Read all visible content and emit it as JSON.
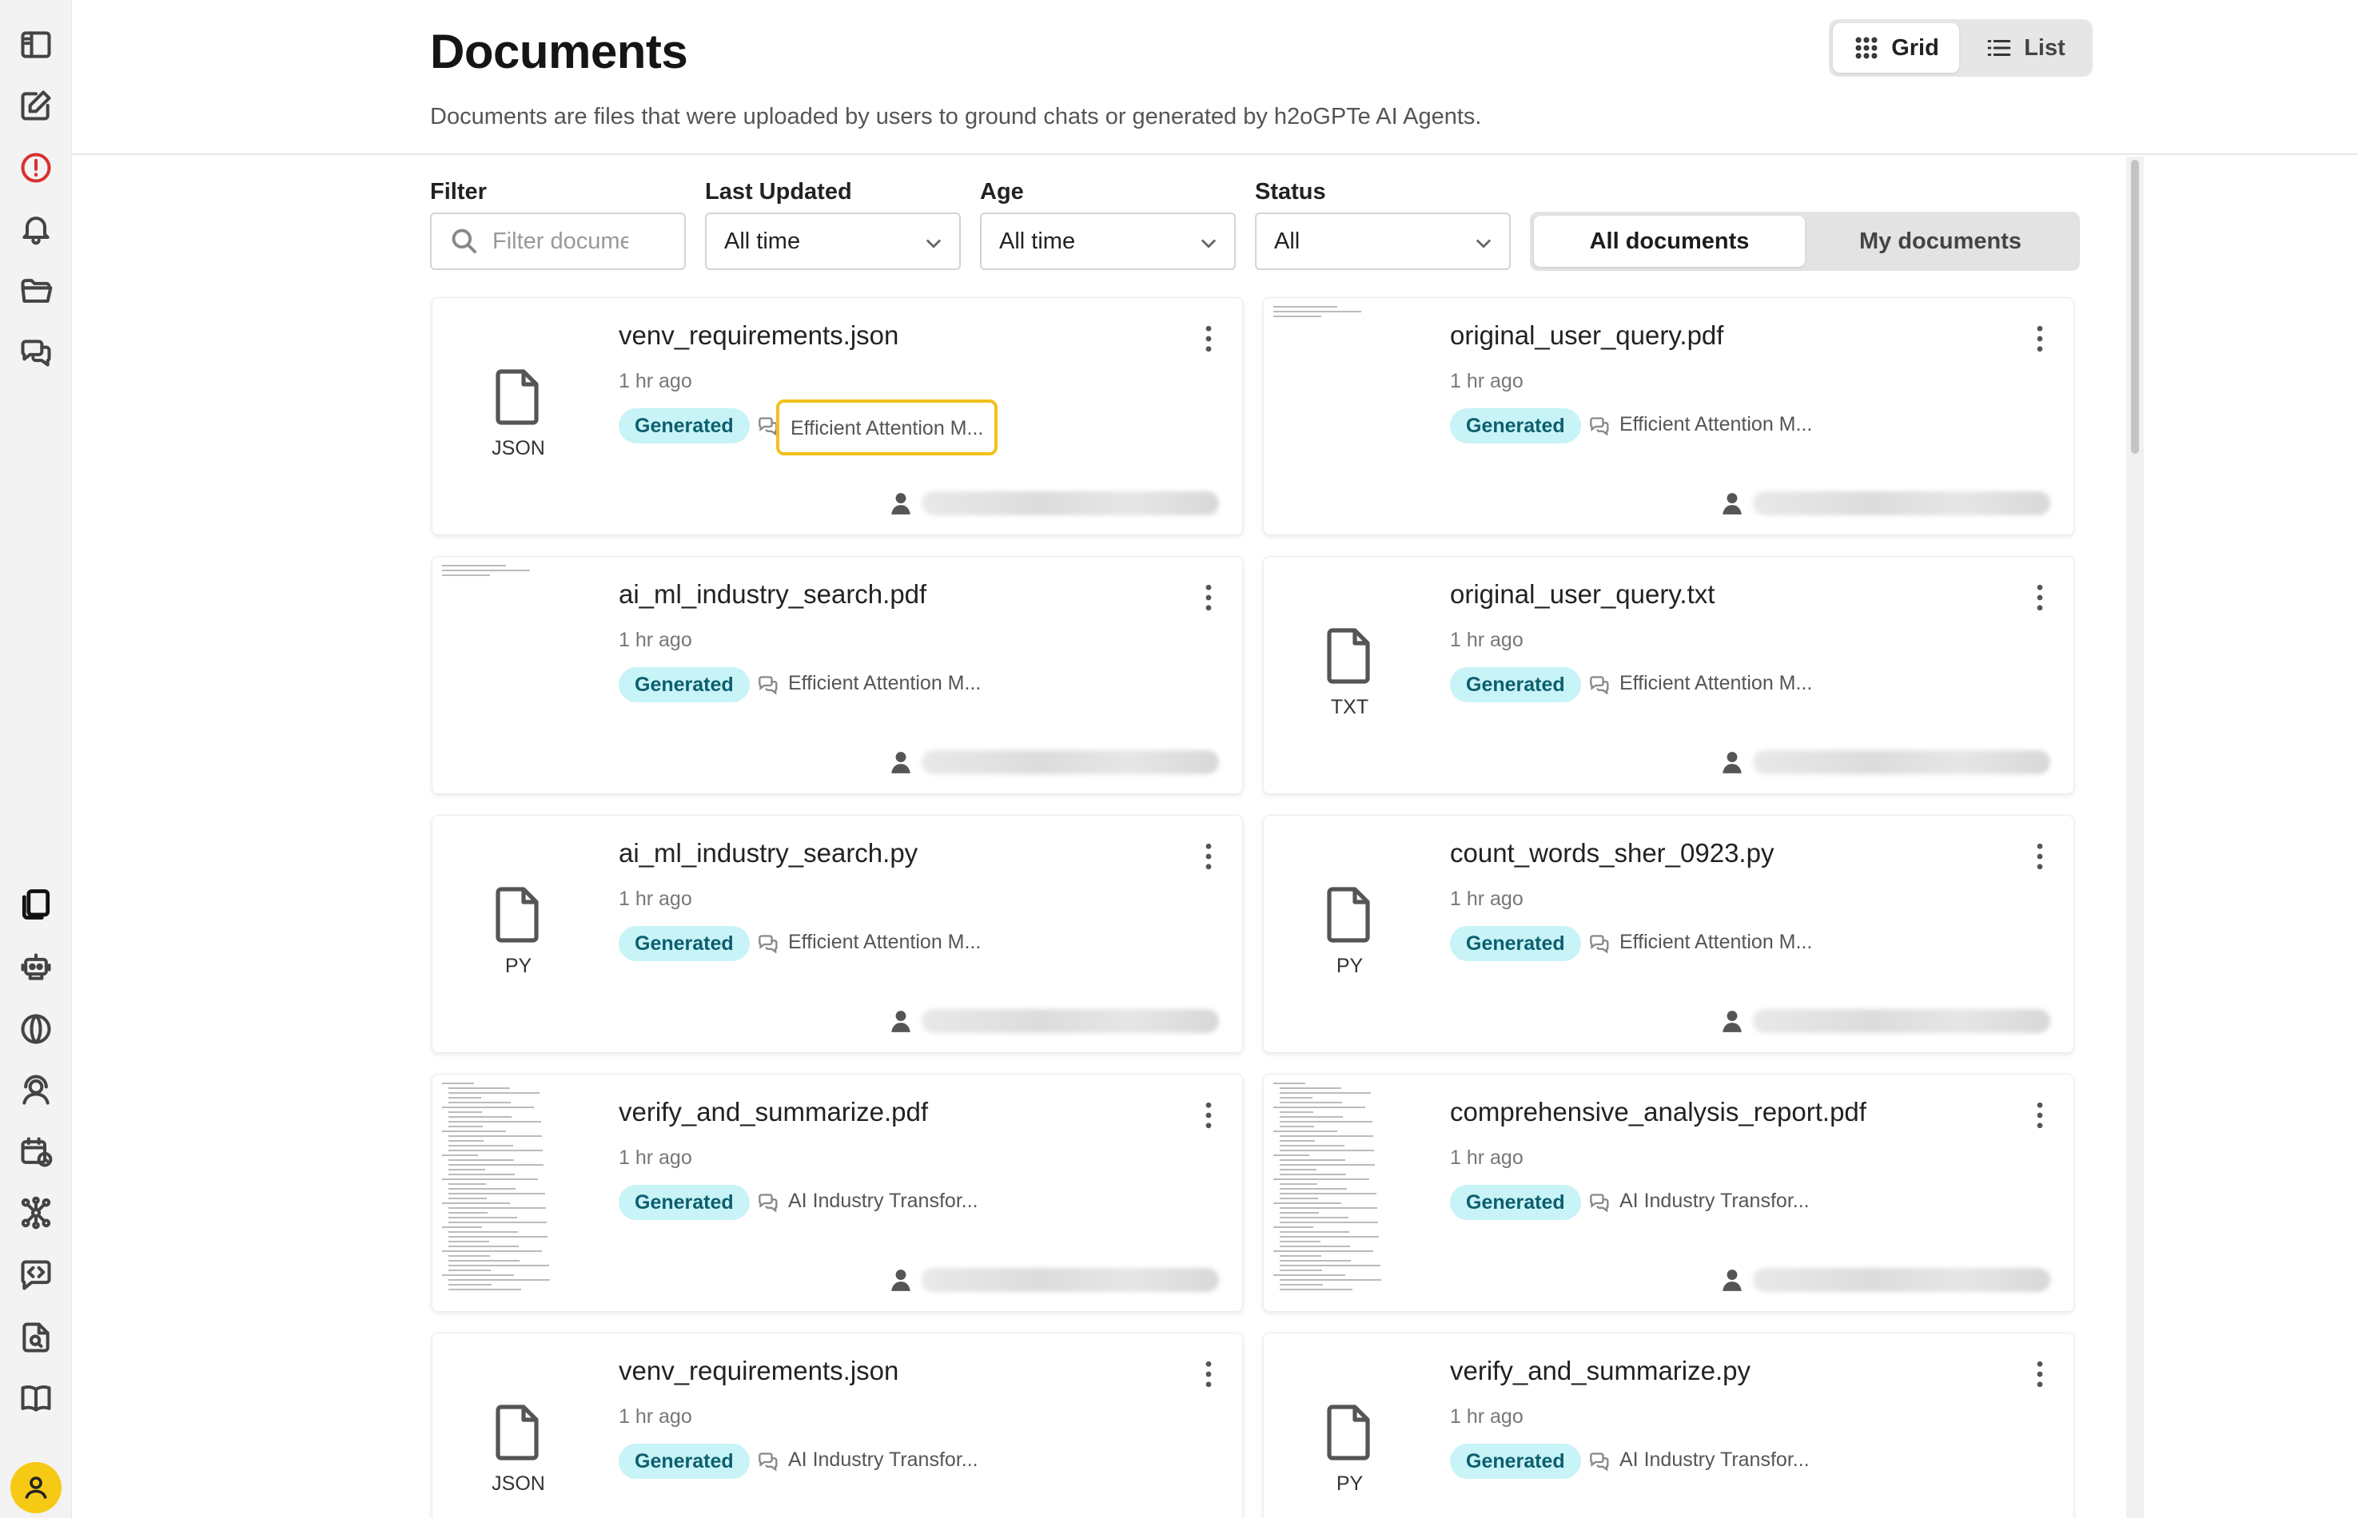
{
  "header": {
    "title": "Documents",
    "description": "Documents are files that were uploaded by users to ground chats or generated by h2oGPTe AI Agents."
  },
  "view_toggle": {
    "grid_label": "Grid",
    "list_label": "List",
    "active": "Grid"
  },
  "filters": {
    "filter_label": "Filter",
    "filter_placeholder": "Filter documents",
    "filter_value": "",
    "last_updated_label": "Last Updated",
    "last_updated_value": "All time",
    "age_label": "Age",
    "age_value": "All time",
    "status_label": "Status",
    "status_value": "All"
  },
  "scope_toggle": {
    "all_label": "All documents",
    "mine_label": "My documents",
    "active": "All documents"
  },
  "sidebar": {
    "icons": [
      "sidebar-toggle-icon",
      "new-chat-icon",
      "alert-icon",
      "bell-icon",
      "folder-icon",
      "chats-icon",
      "documents-icon",
      "agents-icon",
      "models-icon",
      "support-icon",
      "schedule-icon",
      "workflows-icon",
      "code-icon",
      "document-search-icon",
      "book-icon",
      "user-icon"
    ]
  },
  "accent_colors": {
    "badge_bg": "#c8f3f7",
    "badge_text": "#0b5f6e",
    "highlight": "#f1c21b",
    "avatar": "#f6c915"
  },
  "cards": [
    {
      "name": "venv_requirements.json",
      "time": "1 hr ago",
      "badge": "Generated",
      "chat": "Efficient Attention M...",
      "owner": "",
      "ext": "JSON",
      "preview": false
    },
    {
      "name": "original_user_query.pdf",
      "time": "1 hr ago",
      "badge": "Generated",
      "chat": "Efficient Attention M...",
      "owner": "",
      "ext": "",
      "preview": true
    },
    {
      "name": "ai_ml_industry_search.pdf",
      "time": "1 hr ago",
      "badge": "Generated",
      "chat": "Efficient Attention M...",
      "owner": "",
      "ext": "",
      "preview": true
    },
    {
      "name": "original_user_query.txt",
      "time": "1 hr ago",
      "badge": "Generated",
      "chat": "Efficient Attention M...",
      "owner": "",
      "ext": "TXT",
      "preview": false
    },
    {
      "name": "ai_ml_industry_search.py",
      "time": "1 hr ago",
      "badge": "Generated",
      "chat": "Efficient Attention M...",
      "owner": "",
      "ext": "PY",
      "preview": false
    },
    {
      "name": "count_words_sher_0923.py",
      "time": "1 hr ago",
      "badge": "Generated",
      "chat": "Efficient Attention M...",
      "owner": "",
      "ext": "PY",
      "preview": false
    },
    {
      "name": "verify_and_summarize.pdf",
      "time": "1 hr ago",
      "badge": "Generated",
      "chat": "AI Industry Transfor...",
      "owner": "",
      "ext": "",
      "preview": true
    },
    {
      "name": "comprehensive_analysis_report.pdf",
      "time": "1 hr ago",
      "badge": "Generated",
      "chat": "AI Industry Transfor...",
      "owner": "",
      "ext": "",
      "preview": true
    },
    {
      "name": "venv_requirements.json",
      "time": "1 hr ago",
      "badge": "Generated",
      "chat": "AI Industry Transfor...",
      "owner": "",
      "ext": "JSON",
      "preview": false
    },
    {
      "name": "verify_and_summarize.py",
      "time": "1 hr ago",
      "badge": "Generated",
      "chat": "AI Industry Transfor...",
      "owner": "",
      "ext": "PY",
      "preview": false
    }
  ]
}
